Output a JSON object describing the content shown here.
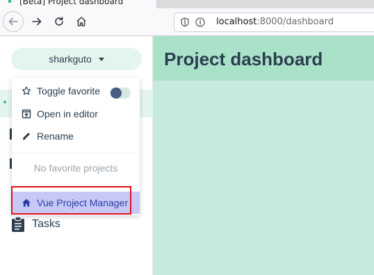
{
  "browser": {
    "tab_title": "[Beta] Project dashboard",
    "url_host": "localhost",
    "url_rest": ":8000/dashboard"
  },
  "app": {
    "project_name": "sharkguto",
    "page_title": "Project dashboard",
    "nav_tasks_label": "Tasks"
  },
  "dropdown": {
    "toggle_favorite_label": "Toggle favorite",
    "toggle_favorite_on": true,
    "open_in_editor_label": "Open in editor",
    "rename_label": "Rename",
    "empty_favorites_label": "No favorite projects",
    "home_label": "Vue Project Manager"
  },
  "colors": {
    "accent": "#42b983",
    "main_bg": "#c6eadb",
    "header_bg": "#a9e2c9",
    "text": "#2c3e50",
    "highlight": "#e0101b"
  }
}
